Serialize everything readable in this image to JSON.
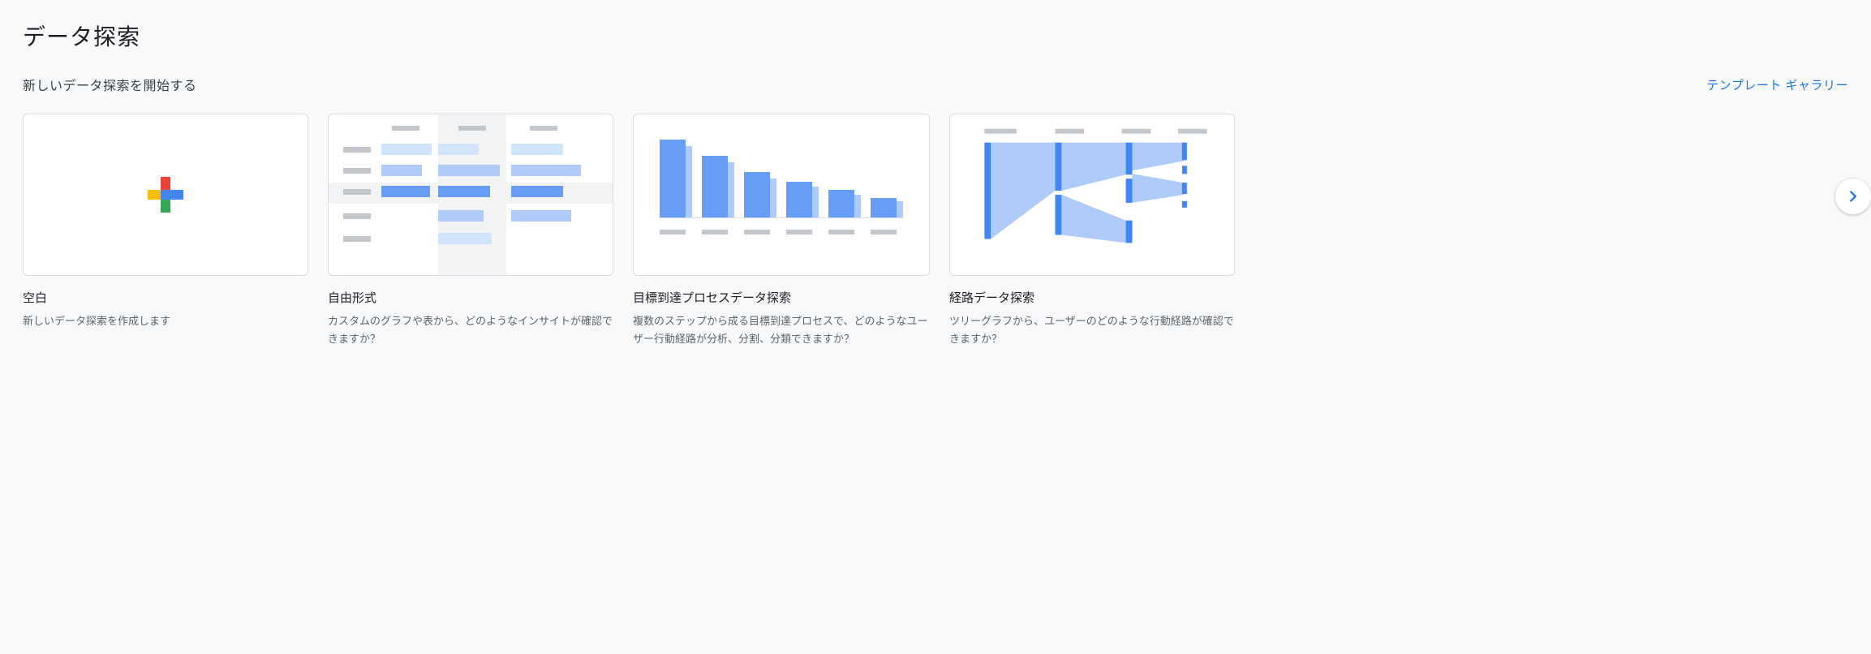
{
  "header": {
    "title": "データ探索",
    "subtitle": "新しいデータ探索を開始する",
    "template_link": "テンプレート ギャラリー"
  },
  "cards": {
    "blank": {
      "title": "空白",
      "desc": "新しいデータ探索を作成します"
    },
    "freeform": {
      "title": "自由形式",
      "desc": "カスタムのグラフや表から、どのようなインサイトが確認できますか？"
    },
    "funnel": {
      "title": "目標到達プロセスデータ探索",
      "desc": "複数のステップから成る目標到達プロセスで、どのようなユーザー行動経路が分析、分割、分類できますか？"
    },
    "path": {
      "title": "経路データ探索",
      "desc": "ツリーグラフから、ユーザーのどのような行動経路が確認できますか？"
    }
  }
}
